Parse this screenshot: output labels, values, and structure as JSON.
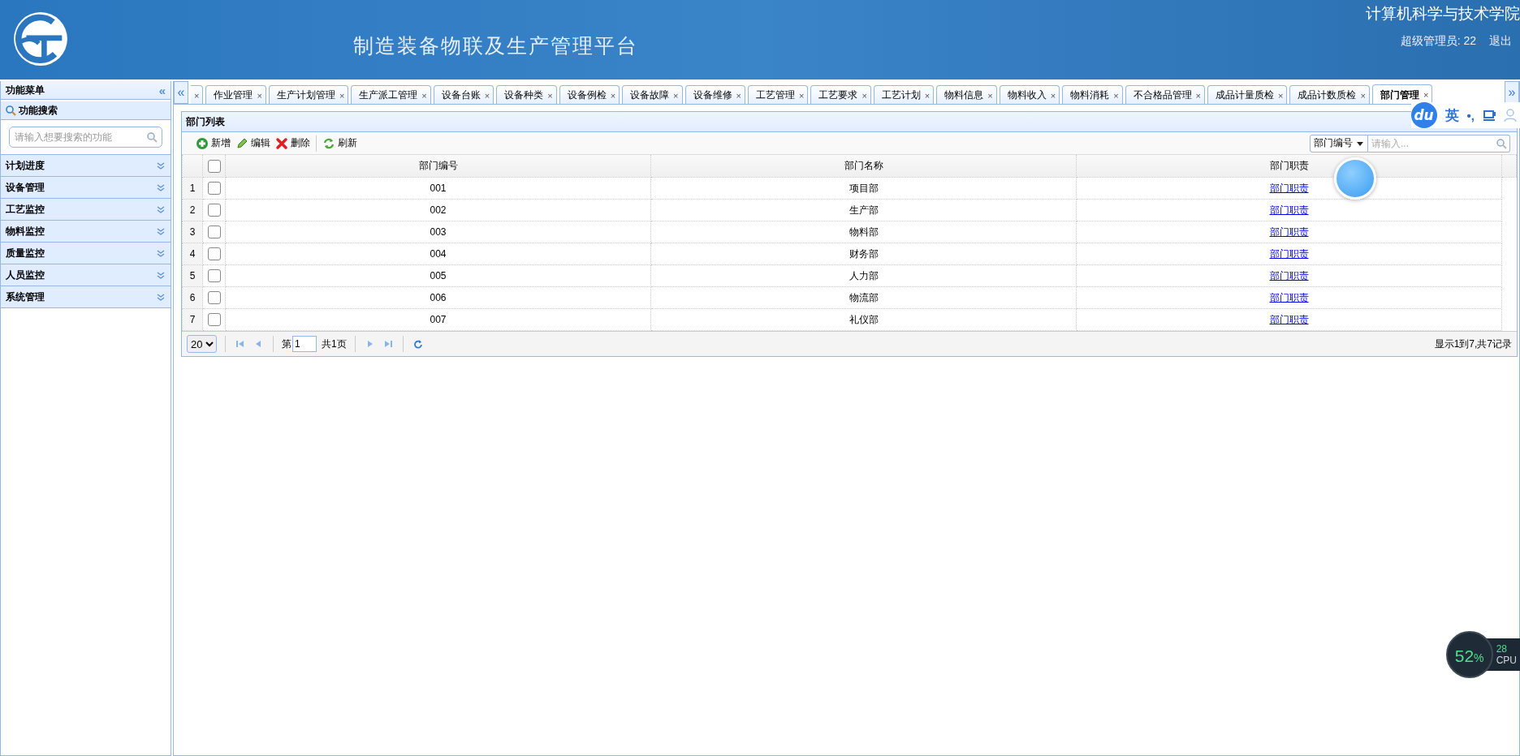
{
  "header": {
    "title": "制造装备物联及生产管理平台",
    "org": "计算机科学与技术学院",
    "user": "超级管理员: 22",
    "logout": "退出"
  },
  "sidebar": {
    "title": "功能菜单",
    "collapse": "«",
    "search_title": "功能搜索",
    "search_placeholder": "请输入想要搜索的功能",
    "menus": [
      {
        "label": "计划进度",
        "expanded": false
      },
      {
        "label": "设备管理",
        "expanded": false
      },
      {
        "label": "工艺监控",
        "expanded": false
      },
      {
        "label": "物料监控",
        "expanded": false
      },
      {
        "label": "质量监控",
        "expanded": false
      },
      {
        "label": "人员监控",
        "expanded": false
      },
      {
        "label": "系统管理",
        "expanded": false
      }
    ]
  },
  "tab_scroll": {
    "left": "«",
    "right": "»"
  },
  "tabs": [
    {
      "kind": "clipped",
      "close": "×",
      "selected": false
    },
    {
      "kind": "tab",
      "label": "作业管理",
      "close": "×",
      "selected": false
    },
    {
      "kind": "tab",
      "label": "生产计划管理",
      "close": "×",
      "selected": false
    },
    {
      "kind": "tab",
      "label": "生产派工管理",
      "close": "×",
      "selected": false
    },
    {
      "kind": "tab",
      "label": "设备台账",
      "close": "×",
      "selected": false
    },
    {
      "kind": "tab",
      "label": "设备种类",
      "close": "×",
      "selected": false
    },
    {
      "kind": "tab",
      "label": "设备例检",
      "close": "×",
      "selected": false
    },
    {
      "kind": "tab",
      "label": "设备故障",
      "close": "×",
      "selected": false
    },
    {
      "kind": "tab",
      "label": "设备维修",
      "close": "×",
      "selected": false
    },
    {
      "kind": "tab",
      "label": "工艺管理",
      "close": "×",
      "selected": false
    },
    {
      "kind": "tab",
      "label": "工艺要求",
      "close": "×",
      "selected": false
    },
    {
      "kind": "tab",
      "label": "工艺计划",
      "close": "×",
      "selected": false
    },
    {
      "kind": "tab",
      "label": "物料信息",
      "close": "×",
      "selected": false
    },
    {
      "kind": "tab",
      "label": "物料收入",
      "close": "×",
      "selected": false
    },
    {
      "kind": "tab",
      "label": "物料消耗",
      "close": "×",
      "selected": false
    },
    {
      "kind": "tab",
      "label": "不合格品管理",
      "close": "×",
      "selected": false
    },
    {
      "kind": "tab",
      "label": "成品计量质检",
      "close": "×",
      "selected": false
    },
    {
      "kind": "tab",
      "label": "成品计数质检",
      "close": "×",
      "selected": false
    },
    {
      "kind": "tab",
      "label": "部门管理",
      "close": "×",
      "selected": true
    }
  ],
  "panel": {
    "title": "部门列表",
    "toolbar": [
      {
        "kind": "add",
        "label": "新增"
      },
      {
        "kind": "edit",
        "label": "编辑"
      },
      {
        "kind": "delete",
        "label": "删除"
      },
      {
        "kind": "refresh",
        "label": "刷新"
      }
    ],
    "search": {
      "field": "部门编号",
      "placeholder": "请输入..."
    },
    "all_checked": false,
    "columns": [
      "部门编号",
      "部门名称",
      "部门职责"
    ],
    "rows": [
      {
        "index": "1",
        "checked": false,
        "code": "001",
        "name": "项目部",
        "link": "部门职责"
      },
      {
        "index": "2",
        "checked": false,
        "code": "002",
        "name": "生产部",
        "link": "部门职责"
      },
      {
        "index": "3",
        "checked": false,
        "code": "003",
        "name": "物料部",
        "link": "部门职责"
      },
      {
        "index": "4",
        "checked": false,
        "code": "004",
        "name": "财务部",
        "link": "部门职责"
      },
      {
        "index": "5",
        "checked": false,
        "code": "005",
        "name": "人力部",
        "link": "部门职责"
      },
      {
        "index": "6",
        "checked": false,
        "code": "006",
        "name": "物流部",
        "link": "部门职责"
      },
      {
        "index": "7",
        "checked": false,
        "code": "007",
        "name": "礼仪部",
        "link": "部门职责"
      }
    ],
    "pager": {
      "page_size": "20",
      "page_prefix": "第",
      "page": "1",
      "total_pages": "共1页",
      "summary": "显示1到7,共7记录"
    }
  },
  "ime": {
    "logo": "du",
    "mode": "英",
    "punct": "•,"
  },
  "cpu": {
    "percent": "52",
    "unit": "%",
    "temp": "28",
    "label": "CPU"
  }
}
